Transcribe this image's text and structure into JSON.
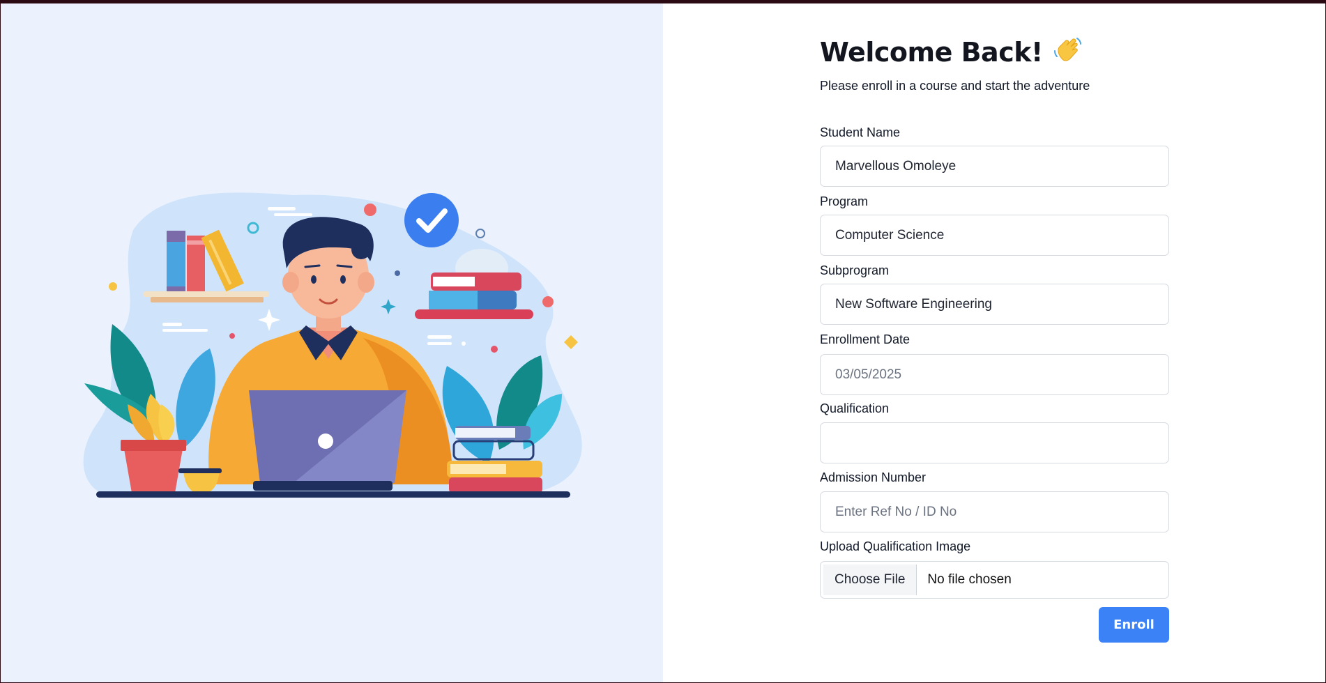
{
  "header": {
    "title": "Welcome Back!",
    "subtitle": "Please enroll in a course and start the adventure"
  },
  "form": {
    "student_name": {
      "label": "Student Name",
      "value": "Marvellous Omoleye"
    },
    "program": {
      "label": "Program",
      "value": "Computer Science"
    },
    "subprogram": {
      "label": "Subprogram",
      "value": "New Software Engineering"
    },
    "enrollment_date": {
      "label": "Enrollment Date",
      "value": "03/05/2025"
    },
    "qualification": {
      "label": "Qualification",
      "value": ""
    },
    "admission_number": {
      "label": "Admission Number",
      "placeholder": "Enter Ref No / ID No"
    },
    "upload": {
      "label": "Upload Qualification Image",
      "button_label": "Choose File",
      "status": "No file chosen"
    },
    "submit_label": "Enroll"
  },
  "icons": {
    "title_emoji": "waving-hand-icon",
    "badge": "check-icon"
  },
  "colors": {
    "accent": "#3b82f6",
    "left_bg": "#ebf2fd",
    "border": "#d5d9e0"
  }
}
